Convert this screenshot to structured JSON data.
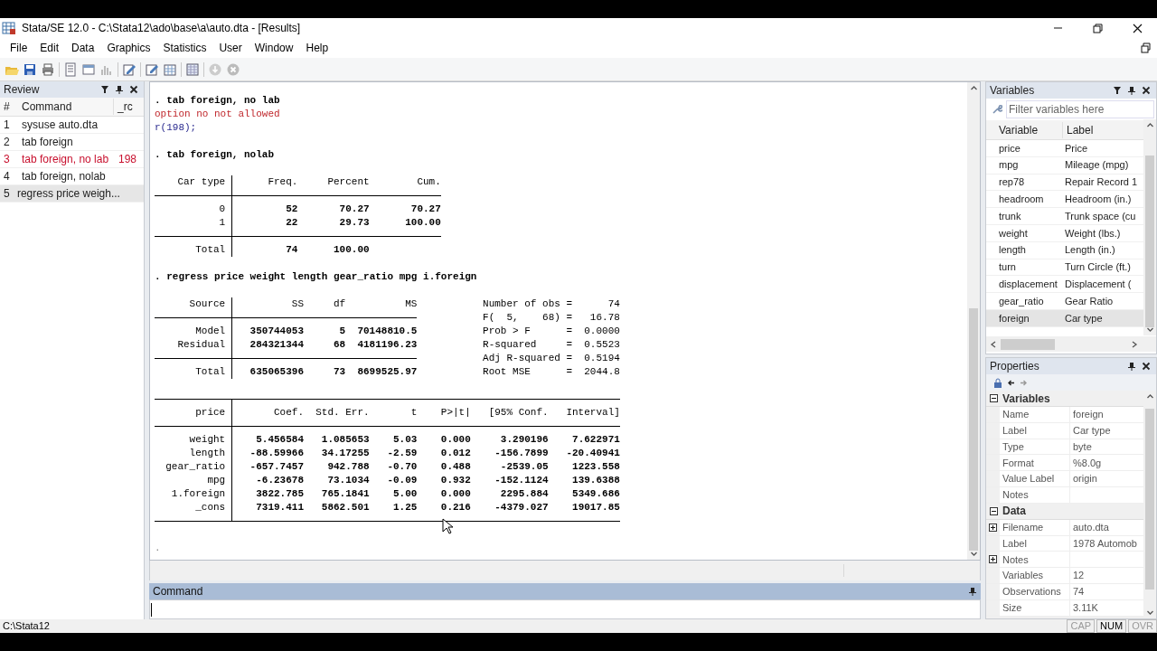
{
  "title_bar": {
    "title": "Stata/SE 12.0 - C:\\Stata12\\ado\\base\\a\\auto.dta - [Results]"
  },
  "menu": [
    "File",
    "Edit",
    "Data",
    "Graphics",
    "Statistics",
    "User",
    "Window",
    "Help"
  ],
  "review": {
    "title": "Review",
    "columns": [
      "#",
      "Command",
      "_rc"
    ],
    "rows": [
      {
        "number": "1",
        "command": "sysuse auto.dta",
        "error": false,
        "selected": false
      },
      {
        "number": "2",
        "command": "tab foreign",
        "error": false,
        "selected": false
      },
      {
        "number": "3",
        "command": "tab foreign, no lab",
        "rc": "198",
        "error": true,
        "selected": false
      },
      {
        "number": "4",
        "command": "tab foreign, nolab",
        "error": false,
        "selected": false
      },
      {
        "number": "5",
        "command": "regress price weigh...",
        "error": false,
        "selected": true
      }
    ]
  },
  "results": {
    "lines": [
      {
        "kind": "command",
        "text": ". tab foreign, no lab"
      },
      {
        "kind": "error",
        "text": "option no not allowed"
      },
      {
        "kind": "return_code",
        "text": "r(198);"
      },
      {
        "kind": "blank"
      },
      {
        "kind": "command",
        "text": ". tab foreign, nolab"
      },
      {
        "kind": "blank"
      },
      {
        "kind": "table",
        "top_rule": false,
        "bottom_rule": false,
        "header": [
          "Car type",
          "Freq.",
          "Percent",
          "Cum."
        ],
        "sections": [
          [
            [
              "0",
              "52",
              "70.27",
              "70.27"
            ],
            [
              "1",
              "22",
              "29.73",
              "100.00"
            ]
          ],
          [
            [
              "Total",
              "74",
              "100.00"
            ]
          ]
        ]
      },
      {
        "kind": "blank"
      },
      {
        "kind": "command",
        "text": ". regress price weight length gear_ratio mpg i.foreign"
      },
      {
        "kind": "blank"
      },
      {
        "kind": "table",
        "top_rule": false,
        "bottom_rule": false,
        "header": [
          "Source",
          "SS",
          "df",
          "MS"
        ],
        "sections": [
          [
            [
              "Model",
              "350744053",
              "5",
              "70148810.5"
            ],
            [
              "Residual",
              "284321344",
              "68",
              "4181196.23"
            ]
          ],
          [
            [
              "Total",
              "635065396",
              "73",
              "8699525.97"
            ]
          ]
        ],
        "side_lines": [
          "Number of obs =      74",
          "F(  5,    68) =   16.78",
          "Prob > F      =  0.0000",
          "R-squared     =  0.5523",
          "Adj R-squared =  0.5194",
          "Root MSE      =  2044.8"
        ]
      },
      {
        "kind": "blank"
      },
      {
        "kind": "table",
        "top_rule": true,
        "bottom_rule": true,
        "header": [
          "price",
          "Coef.",
          "Std. Err.",
          "t",
          "P>|t|",
          "[95% Conf.",
          "Interval]"
        ],
        "sections": [
          [
            [
              "weight",
              "5.456584",
              "1.085653",
              "5.03",
              "0.000",
              "3.290196",
              "7.622971"
            ],
            [
              "length",
              "-88.59966",
              "34.17255",
              "-2.59",
              "0.012",
              "-156.7899",
              "-20.40941"
            ],
            [
              "gear_ratio",
              "-657.7457",
              "942.788",
              "-0.70",
              "0.488",
              "-2539.05",
              "1223.558"
            ],
            [
              "mpg",
              "-6.23678",
              "73.1034",
              "-0.09",
              "0.932",
              "-152.1124",
              "139.6388"
            ],
            [
              "1.foreign",
              "3822.785",
              "765.1841",
              "5.00",
              "0.000",
              "2295.884",
              "5349.686"
            ],
            [
              "_cons",
              "7319.411",
              "5862.501",
              "1.25",
              "0.216",
              "-4379.027",
              "19017.85"
            ]
          ]
        ]
      },
      {
        "kind": "blank"
      },
      {
        "kind": "prompt",
        "text": "."
      }
    ]
  },
  "command_pane": {
    "title": "Command"
  },
  "variables": {
    "title": "Variables",
    "filter_placeholder": "Filter variables here",
    "columns": [
      "Variable",
      "Label"
    ],
    "rows": [
      {
        "name": "price",
        "label": "Price",
        "selected": false
      },
      {
        "name": "mpg",
        "label": "Mileage (mpg)",
        "selected": false
      },
      {
        "name": "rep78",
        "label": "Repair Record 1",
        "selected": false
      },
      {
        "name": "headroom",
        "label": "Headroom (in.)",
        "selected": false
      },
      {
        "name": "trunk",
        "label": "Trunk space (cu",
        "selected": false
      },
      {
        "name": "weight",
        "label": "Weight (lbs.)",
        "selected": false
      },
      {
        "name": "length",
        "label": "Length (in.)",
        "selected": false
      },
      {
        "name": "turn",
        "label": "Turn Circle (ft.)",
        "selected": false
      },
      {
        "name": "displacement",
        "label": "Displacement (",
        "selected": false
      },
      {
        "name": "gear_ratio",
        "label": "Gear Ratio",
        "selected": false
      },
      {
        "name": "foreign",
        "label": "Car type",
        "selected": true
      }
    ]
  },
  "properties": {
    "title": "Properties",
    "groups": [
      {
        "title": "Variables",
        "expanded": true,
        "rows": [
          {
            "name": "Name",
            "value": "foreign",
            "expandable": false
          },
          {
            "name": "Label",
            "value": "Car type",
            "expandable": false
          },
          {
            "name": "Type",
            "value": "byte",
            "expandable": false
          },
          {
            "name": "Format",
            "value": "%8.0g",
            "expandable": false
          },
          {
            "name": "Value Label",
            "value": "origin",
            "expandable": false
          },
          {
            "name": "Notes",
            "expandable": false
          }
        ]
      },
      {
        "title": "Data",
        "expanded": true,
        "rows": [
          {
            "name": "Filename",
            "value": "auto.dta",
            "expandable": true
          },
          {
            "name": "Label",
            "value": "1978 Automob",
            "expandable": false
          },
          {
            "name": "Notes",
            "expandable": true
          },
          {
            "name": "Variables",
            "value": "12",
            "expandable": false
          },
          {
            "name": "Observations",
            "value": "74",
            "expandable": false
          },
          {
            "name": "Size",
            "value": "3.11K",
            "expandable": false
          }
        ]
      }
    ]
  },
  "status_bar": {
    "path": "C:\\Stata12",
    "indicators": [
      {
        "label": "CAP",
        "on": false
      },
      {
        "label": "NUM",
        "on": true
      },
      {
        "label": "OVR",
        "on": false
      }
    ]
  }
}
